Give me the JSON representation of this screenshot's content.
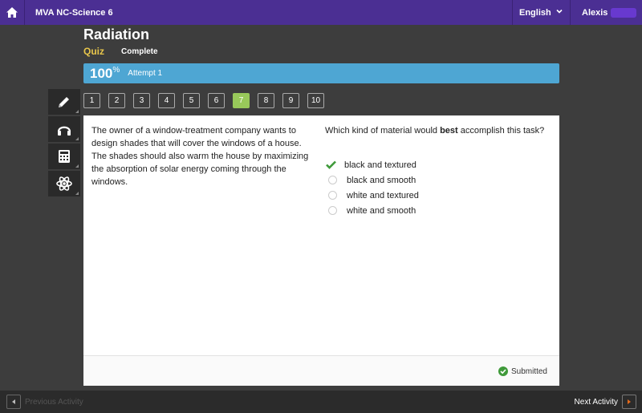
{
  "topbar": {
    "course_title": "MVA NC-Science 6",
    "language": "English",
    "user_name": "Alexis"
  },
  "header": {
    "lesson_title": "Radiation",
    "activity_type": "Quiz",
    "status": "Complete"
  },
  "score_bar": {
    "score": "100",
    "score_unit": "%",
    "attempt": "Attempt 1"
  },
  "tools": [
    {
      "icon": "pencil-icon"
    },
    {
      "icon": "headphones-icon"
    },
    {
      "icon": "calculator-icon"
    },
    {
      "icon": "atom-icon"
    }
  ],
  "question_nav": {
    "items": [
      "1",
      "2",
      "3",
      "4",
      "5",
      "6",
      "7",
      "8",
      "9",
      "10"
    ],
    "active": 7
  },
  "passage": "The owner of a window-treatment company wants to design shades that will cover the windows of a house. The shades should also warm the house by maximizing the absorption of solar energy coming through the windows.",
  "question": {
    "prefix": "Which kind of material would ",
    "emphasis": "best",
    "suffix": " accomplish this task?"
  },
  "choices": [
    {
      "label": "black and textured",
      "selected": true
    },
    {
      "label": "black and smooth",
      "selected": false
    },
    {
      "label": "white and textured",
      "selected": false
    },
    {
      "label": "white and smooth",
      "selected": false
    }
  ],
  "footer": {
    "status": "Submitted"
  },
  "bottombar": {
    "previous_label": "Previous Activity",
    "next_label": "Next Activity"
  },
  "colors": {
    "topbar": "#4b2f93",
    "score_bar": "#4ea6d3",
    "active_question": "#98c85a",
    "check": "#3f9a3a",
    "next_arrow": "#e36a1c"
  }
}
